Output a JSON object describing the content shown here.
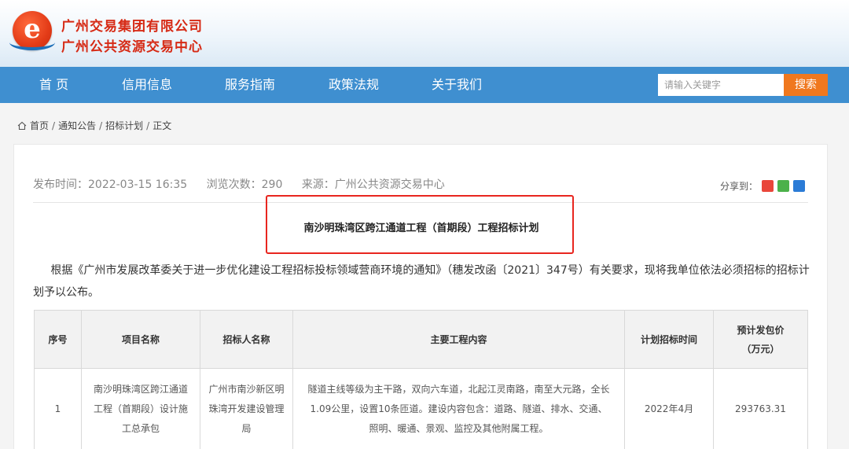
{
  "header": {
    "logo_letter": "e",
    "org_line1": "广州交易集团有限公司",
    "org_line2": "广州公共资源交易中心"
  },
  "nav": {
    "items": [
      "首 页",
      "信用信息",
      "服务指南",
      "政策法规",
      "关于我们"
    ],
    "search_placeholder": "请输入关键字",
    "search_label": "搜索"
  },
  "breadcrumb": [
    "首页",
    "通知公告",
    "招标计划",
    "正文"
  ],
  "article": {
    "publish_time": "发布时间：2022-03-15 16:35",
    "views": "浏览次数：290",
    "source": "来源：广州公共资源交易中心",
    "share_label": "分享到：",
    "title": "南沙明珠湾区跨江通道工程（首期段）工程招标计划",
    "intro": "根据《广州市发展改革委关于进一步优化建设工程招标投标领域营商环境的通知》（穗发改函〔2021〕347号）有关要求，现将我单位依法必须招标的招标计划予以公布。"
  },
  "table": {
    "headers": [
      "序号",
      "项目名称",
      "招标人名称",
      "主要工程内容",
      "计划招标时间",
      "预计发包价（万元）"
    ],
    "rows": [
      [
        "1",
        "南沙明珠湾区跨江通道工程（首期段）设计施工总承包",
        "广州市南沙新区明珠湾开发建设管理局",
        "隧道主线等级为主干路，双向六车道，北起江灵南路，南至大元路，全长1.09公里，设置10条匝道。建设内容包含：道路、隧道、排水、交通、照明、暖通、景观、监控及其他附属工程。",
        "2022年4月",
        "293763.31"
      ]
    ]
  },
  "colors": {
    "nav": "#3f8fd0",
    "search_button": "#f0781e",
    "org_name": "#d62a15",
    "highlight_box": "#e8261f"
  }
}
